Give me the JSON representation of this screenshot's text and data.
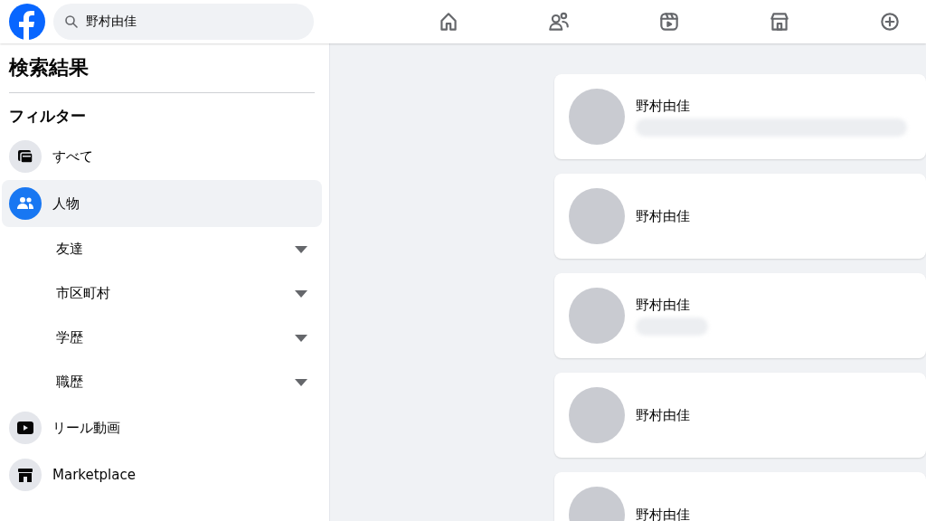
{
  "search": {
    "value": "野村由佳"
  },
  "sidebar": {
    "title": "検索結果",
    "filter_heading": "フィルター",
    "items": [
      {
        "kind": "category",
        "label": "すべて",
        "selected": false
      },
      {
        "kind": "category",
        "label": "人物",
        "selected": true
      },
      {
        "kind": "subfilter",
        "label": "友達"
      },
      {
        "kind": "subfilter",
        "label": "市区町村"
      },
      {
        "kind": "subfilter",
        "label": "学歴"
      },
      {
        "kind": "subfilter",
        "label": "職歴"
      },
      {
        "kind": "category",
        "label": "リール動画",
        "selected": false
      },
      {
        "kind": "category",
        "label": "Marketplace",
        "selected": false
      }
    ]
  },
  "results": [
    {
      "name": "野村由佳",
      "kind": "with_detail"
    },
    {
      "name": "野村由佳",
      "kind": "name_only"
    },
    {
      "name": "野村由佳",
      "kind": "with_detail"
    },
    {
      "name": "野村由佳",
      "kind": "name_only"
    },
    {
      "name": "野村由佳",
      "kind": "name_only"
    }
  ]
}
